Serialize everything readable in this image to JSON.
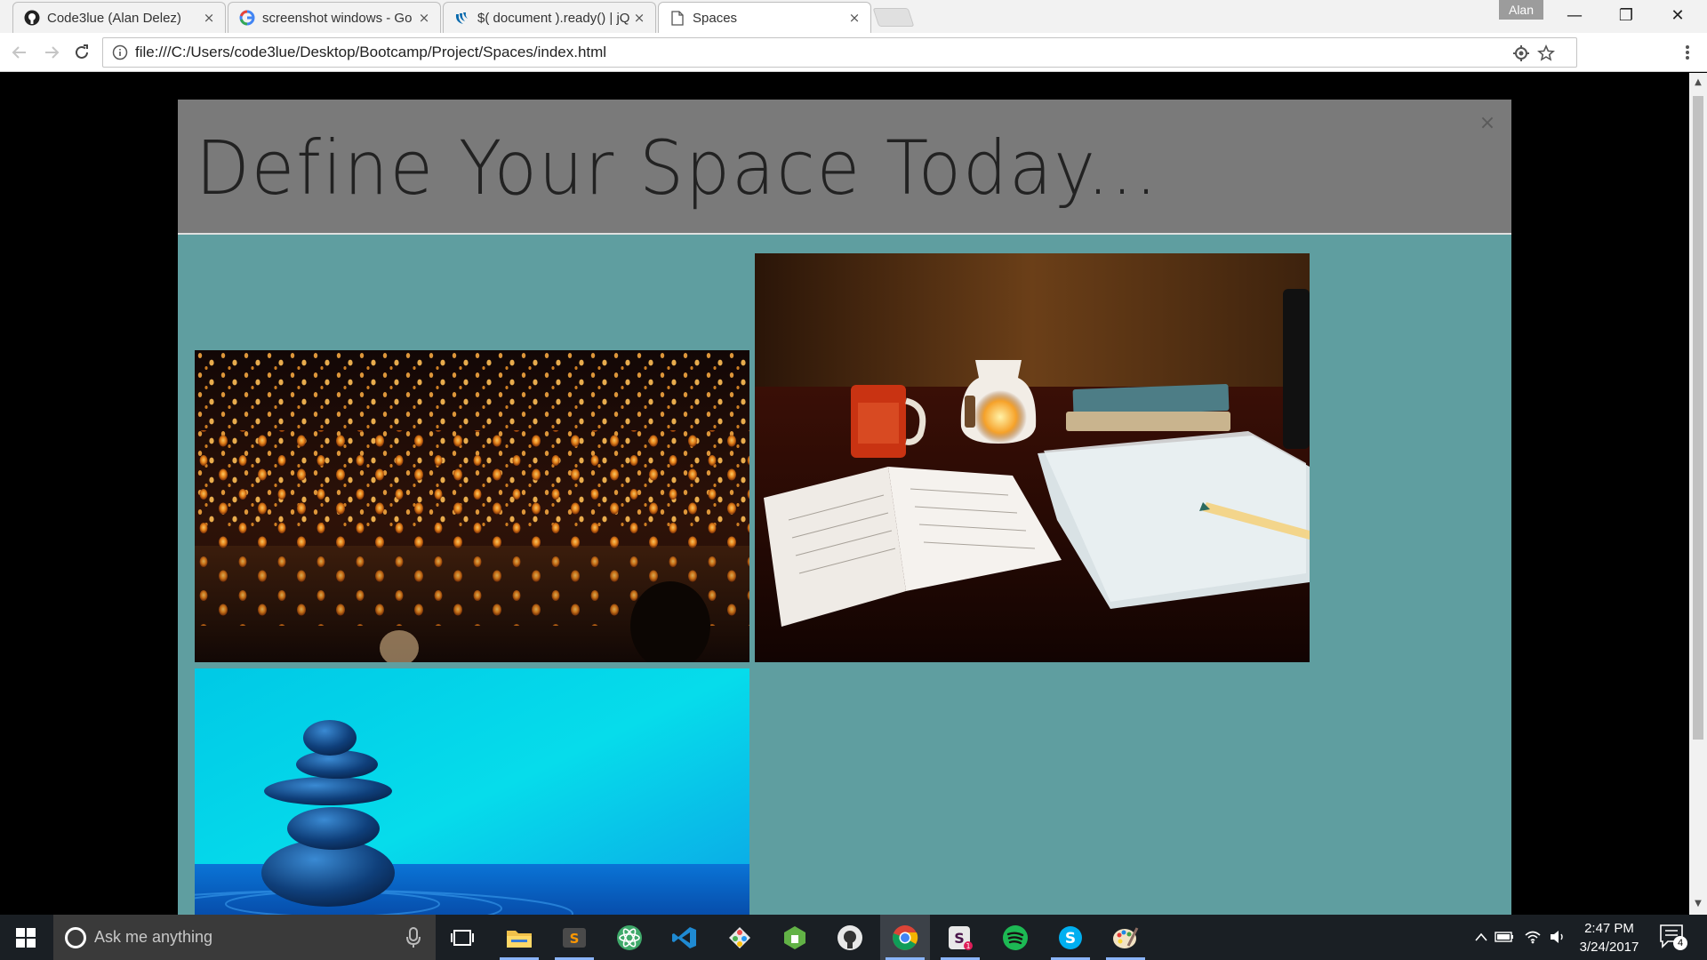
{
  "browser": {
    "tabs": [
      {
        "title": "Code3lue (Alan Delez)",
        "icon": "github-icon",
        "close": "×"
      },
      {
        "title": "screenshot windows - Go",
        "icon": "google-icon",
        "close": "×"
      },
      {
        "title": "$( document ).ready() | jQ",
        "icon": "jquery-icon",
        "close": "×"
      },
      {
        "title": "Spaces",
        "icon": "page-icon",
        "close": "×"
      }
    ],
    "profile_name": "Alan",
    "window_controls": {
      "minimize": "—",
      "restore": "❐",
      "close": "✕"
    },
    "url": "file:///C:/Users/code3lue/Desktop/Bootcamp/Project/Spaces/index.html"
  },
  "page": {
    "title": "Define Your Space Today...",
    "close_symbol": "×",
    "tiles": [
      {
        "name": "sky-lanterns-image",
        "subject": "sky lanterns festival at night"
      },
      {
        "name": "desk-notebook-image",
        "subject": "desk with notebook, mug and oil burner"
      },
      {
        "name": "zen-stones-image",
        "subject": "stacked zen stones on blue water"
      }
    ]
  },
  "taskbar": {
    "search_placeholder": "Ask me anything",
    "apps": [
      "file-explorer",
      "sublime-text",
      "atom",
      "visual-studio-code",
      "git-kraken",
      "node",
      "github-desktop",
      "chrome",
      "slack",
      "spotify",
      "skype",
      "paint"
    ],
    "time": "2:47 PM",
    "date": "3/24/2017",
    "notification_count": "4"
  },
  "colors": {
    "modal_body": "#5f9ea0",
    "modal_header": "#7a7a7a",
    "backdrop": "#000000",
    "taskbar": "#1a1f24"
  }
}
